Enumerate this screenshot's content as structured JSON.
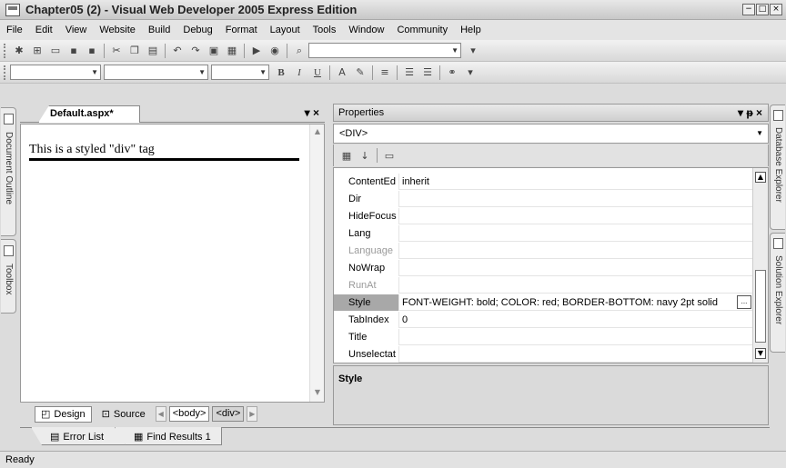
{
  "window": {
    "title": "Chapter05 (2) - Visual Web Developer 2005 Express Edition",
    "controls": [
      "−",
      "□",
      "×"
    ]
  },
  "menubar": {
    "items": [
      "File",
      "Edit",
      "View",
      "Website",
      "Build",
      "Debug",
      "Format",
      "Layout",
      "Tools",
      "Window",
      "Community",
      "Help"
    ]
  },
  "formatting_toolbar": {
    "bold": "B",
    "italic": "I",
    "underline": "U"
  },
  "left_tabs": {
    "document_outline": "Document Outline",
    "toolbox": "Toolbox"
  },
  "right_tabs": {
    "database_explorer": "Database Explorer",
    "solution_explorer": "Solution Explorer"
  },
  "document": {
    "tab_label": "Default.aspx*",
    "tab_controls": "▾ ×",
    "content_text": "This is a styled \"div\" tag",
    "view_buttons": {
      "design": "Design",
      "source": "Source"
    },
    "tag_path": [
      "<body>",
      "<div>"
    ],
    "selected_tag": "<div>"
  },
  "properties": {
    "title": "Properties",
    "title_controls": "▾ ᵽ ×",
    "object": "<DIV>",
    "rows": [
      {
        "name": "ContentEd",
        "value": "inherit",
        "dim": false,
        "selected": false
      },
      {
        "name": "Dir",
        "value": "",
        "dim": false,
        "selected": false
      },
      {
        "name": "HideFocus",
        "value": "",
        "dim": false,
        "selected": false
      },
      {
        "name": "Lang",
        "value": "",
        "dim": false,
        "selected": false
      },
      {
        "name": "Language",
        "value": "",
        "dim": true,
        "selected": false
      },
      {
        "name": "NoWrap",
        "value": "",
        "dim": false,
        "selected": false
      },
      {
        "name": "RunAt",
        "value": "",
        "dim": true,
        "selected": false
      },
      {
        "name": "Style",
        "value": "FONT-WEIGHT: bold; COLOR: red; BORDER-BOTTOM: navy 2pt solid",
        "dim": false,
        "selected": true
      },
      {
        "name": "TabIndex",
        "value": "0",
        "dim": false,
        "selected": false
      },
      {
        "name": "Title",
        "value": "",
        "dim": false,
        "selected": false
      },
      {
        "name": "Unselectat",
        "value": "",
        "dim": false,
        "selected": false
      }
    ],
    "ellipsis_button": "...",
    "description_title": "Style"
  },
  "bottom_tabs": {
    "error_list": "Error List",
    "find_results": "Find Results 1"
  },
  "status": {
    "text": "Ready"
  }
}
